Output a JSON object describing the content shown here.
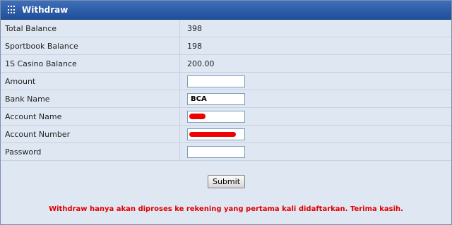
{
  "panel": {
    "title": "Withdraw"
  },
  "rows": [
    {
      "label": "Total Balance",
      "value": "398"
    },
    {
      "label": "Sportbook Balance",
      "value": "198"
    },
    {
      "label": "1S Casino Balance",
      "value": "200.00"
    },
    {
      "label": "Amount",
      "input_value": ""
    },
    {
      "label": "Bank Name",
      "input_value": "BCA"
    },
    {
      "label": "Account Name",
      "input_value": ""
    },
    {
      "label": "Account Number",
      "input_value": ""
    },
    {
      "label": "Password",
      "input_value": ""
    }
  ],
  "submit_label": "Submit",
  "notice": "Withdraw hanya akan diproses ke rekening yang pertama kali didaftarkan. Terima kasih.",
  "colors": {
    "header": "#2a5aa8",
    "panel_bg": "#dfe7f3",
    "notice": "#e00000",
    "redaction": "#f00000"
  }
}
